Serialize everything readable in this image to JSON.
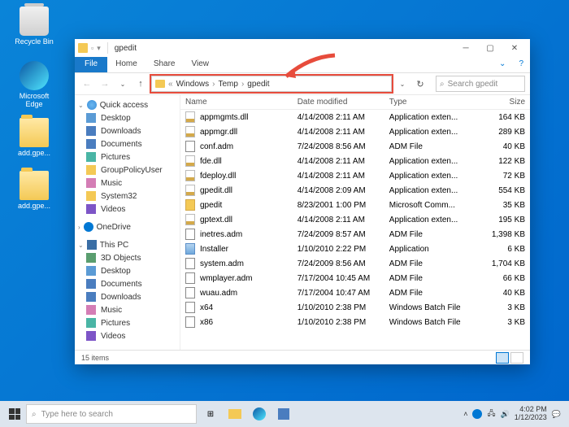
{
  "desktop": {
    "recycle": "Recycle Bin",
    "edge": "Microsoft Edge",
    "folder1": "add.gpe...",
    "folder2": "add.gpe..."
  },
  "window": {
    "title": "gpedit",
    "tabs": {
      "file": "File",
      "home": "Home",
      "share": "Share",
      "view": "View"
    },
    "breadcrumb": {
      "sep0": "«",
      "p1": "Windows",
      "p2": "Temp",
      "p3": "gpedit"
    },
    "search_placeholder": "Search gpedit",
    "columns": {
      "name": "Name",
      "date": "Date modified",
      "type": "Type",
      "size": "Size"
    },
    "status": "15 items"
  },
  "sidebar": {
    "quick": "Quick access",
    "desktop": "Desktop",
    "downloads": "Downloads",
    "documents": "Documents",
    "pictures": "Pictures",
    "gpu": "GroupPolicyUser",
    "music": "Music",
    "system32": "System32",
    "videos": "Videos",
    "onedrive": "OneDrive",
    "thispc": "This PC",
    "objects": "3D Objects",
    "desktop2": "Desktop",
    "documents2": "Documents",
    "downloads2": "Downloads",
    "music2": "Music",
    "pictures2": "Pictures",
    "videos2": "Videos"
  },
  "files": [
    {
      "name": "appmgmts.dll",
      "date": "4/14/2008 2:11 AM",
      "type": "Application exten...",
      "size": "164 KB",
      "ic": "dll"
    },
    {
      "name": "appmgr.dll",
      "date": "4/14/2008 2:11 AM",
      "type": "Application exten...",
      "size": "289 KB",
      "ic": "dll"
    },
    {
      "name": "conf.adm",
      "date": "7/24/2008 8:56 AM",
      "type": "ADM File",
      "size": "40 KB",
      "ic": "adm"
    },
    {
      "name": "fde.dll",
      "date": "4/14/2008 2:11 AM",
      "type": "Application exten...",
      "size": "122 KB",
      "ic": "dll"
    },
    {
      "name": "fdeploy.dll",
      "date": "4/14/2008 2:11 AM",
      "type": "Application exten...",
      "size": "72 KB",
      "ic": "dll"
    },
    {
      "name": "gpedit.dll",
      "date": "4/14/2008 2:09 AM",
      "type": "Application exten...",
      "size": "554 KB",
      "ic": "dll"
    },
    {
      "name": "gpedit",
      "date": "8/23/2001 1:00 PM",
      "type": "Microsoft Comm...",
      "size": "35 KB",
      "ic": "exe"
    },
    {
      "name": "gptext.dll",
      "date": "4/14/2008 2:11 AM",
      "type": "Application exten...",
      "size": "195 KB",
      "ic": "dll"
    },
    {
      "name": "inetres.adm",
      "date": "7/24/2009 8:57 AM",
      "type": "ADM File",
      "size": "1,398 KB",
      "ic": "adm"
    },
    {
      "name": "Installer",
      "date": "1/10/2010 2:22 PM",
      "type": "Application",
      "size": "6 KB",
      "ic": "app"
    },
    {
      "name": "system.adm",
      "date": "7/24/2009 8:56 AM",
      "type": "ADM File",
      "size": "1,704 KB",
      "ic": "adm"
    },
    {
      "name": "wmplayer.adm",
      "date": "7/17/2004 10:45 AM",
      "type": "ADM File",
      "size": "66 KB",
      "ic": "adm"
    },
    {
      "name": "wuau.adm",
      "date": "7/17/2004 10:47 AM",
      "type": "ADM File",
      "size": "40 KB",
      "ic": "adm"
    },
    {
      "name": "x64",
      "date": "1/10/2010 2:38 PM",
      "type": "Windows Batch File",
      "size": "3 KB",
      "ic": "bat"
    },
    {
      "name": "x86",
      "date": "1/10/2010 2:38 PM",
      "type": "Windows Batch File",
      "size": "3 KB",
      "ic": "bat"
    }
  ],
  "taskbar": {
    "search": "Type here to search",
    "time": "4:02 PM",
    "date": "1/12/2023"
  }
}
